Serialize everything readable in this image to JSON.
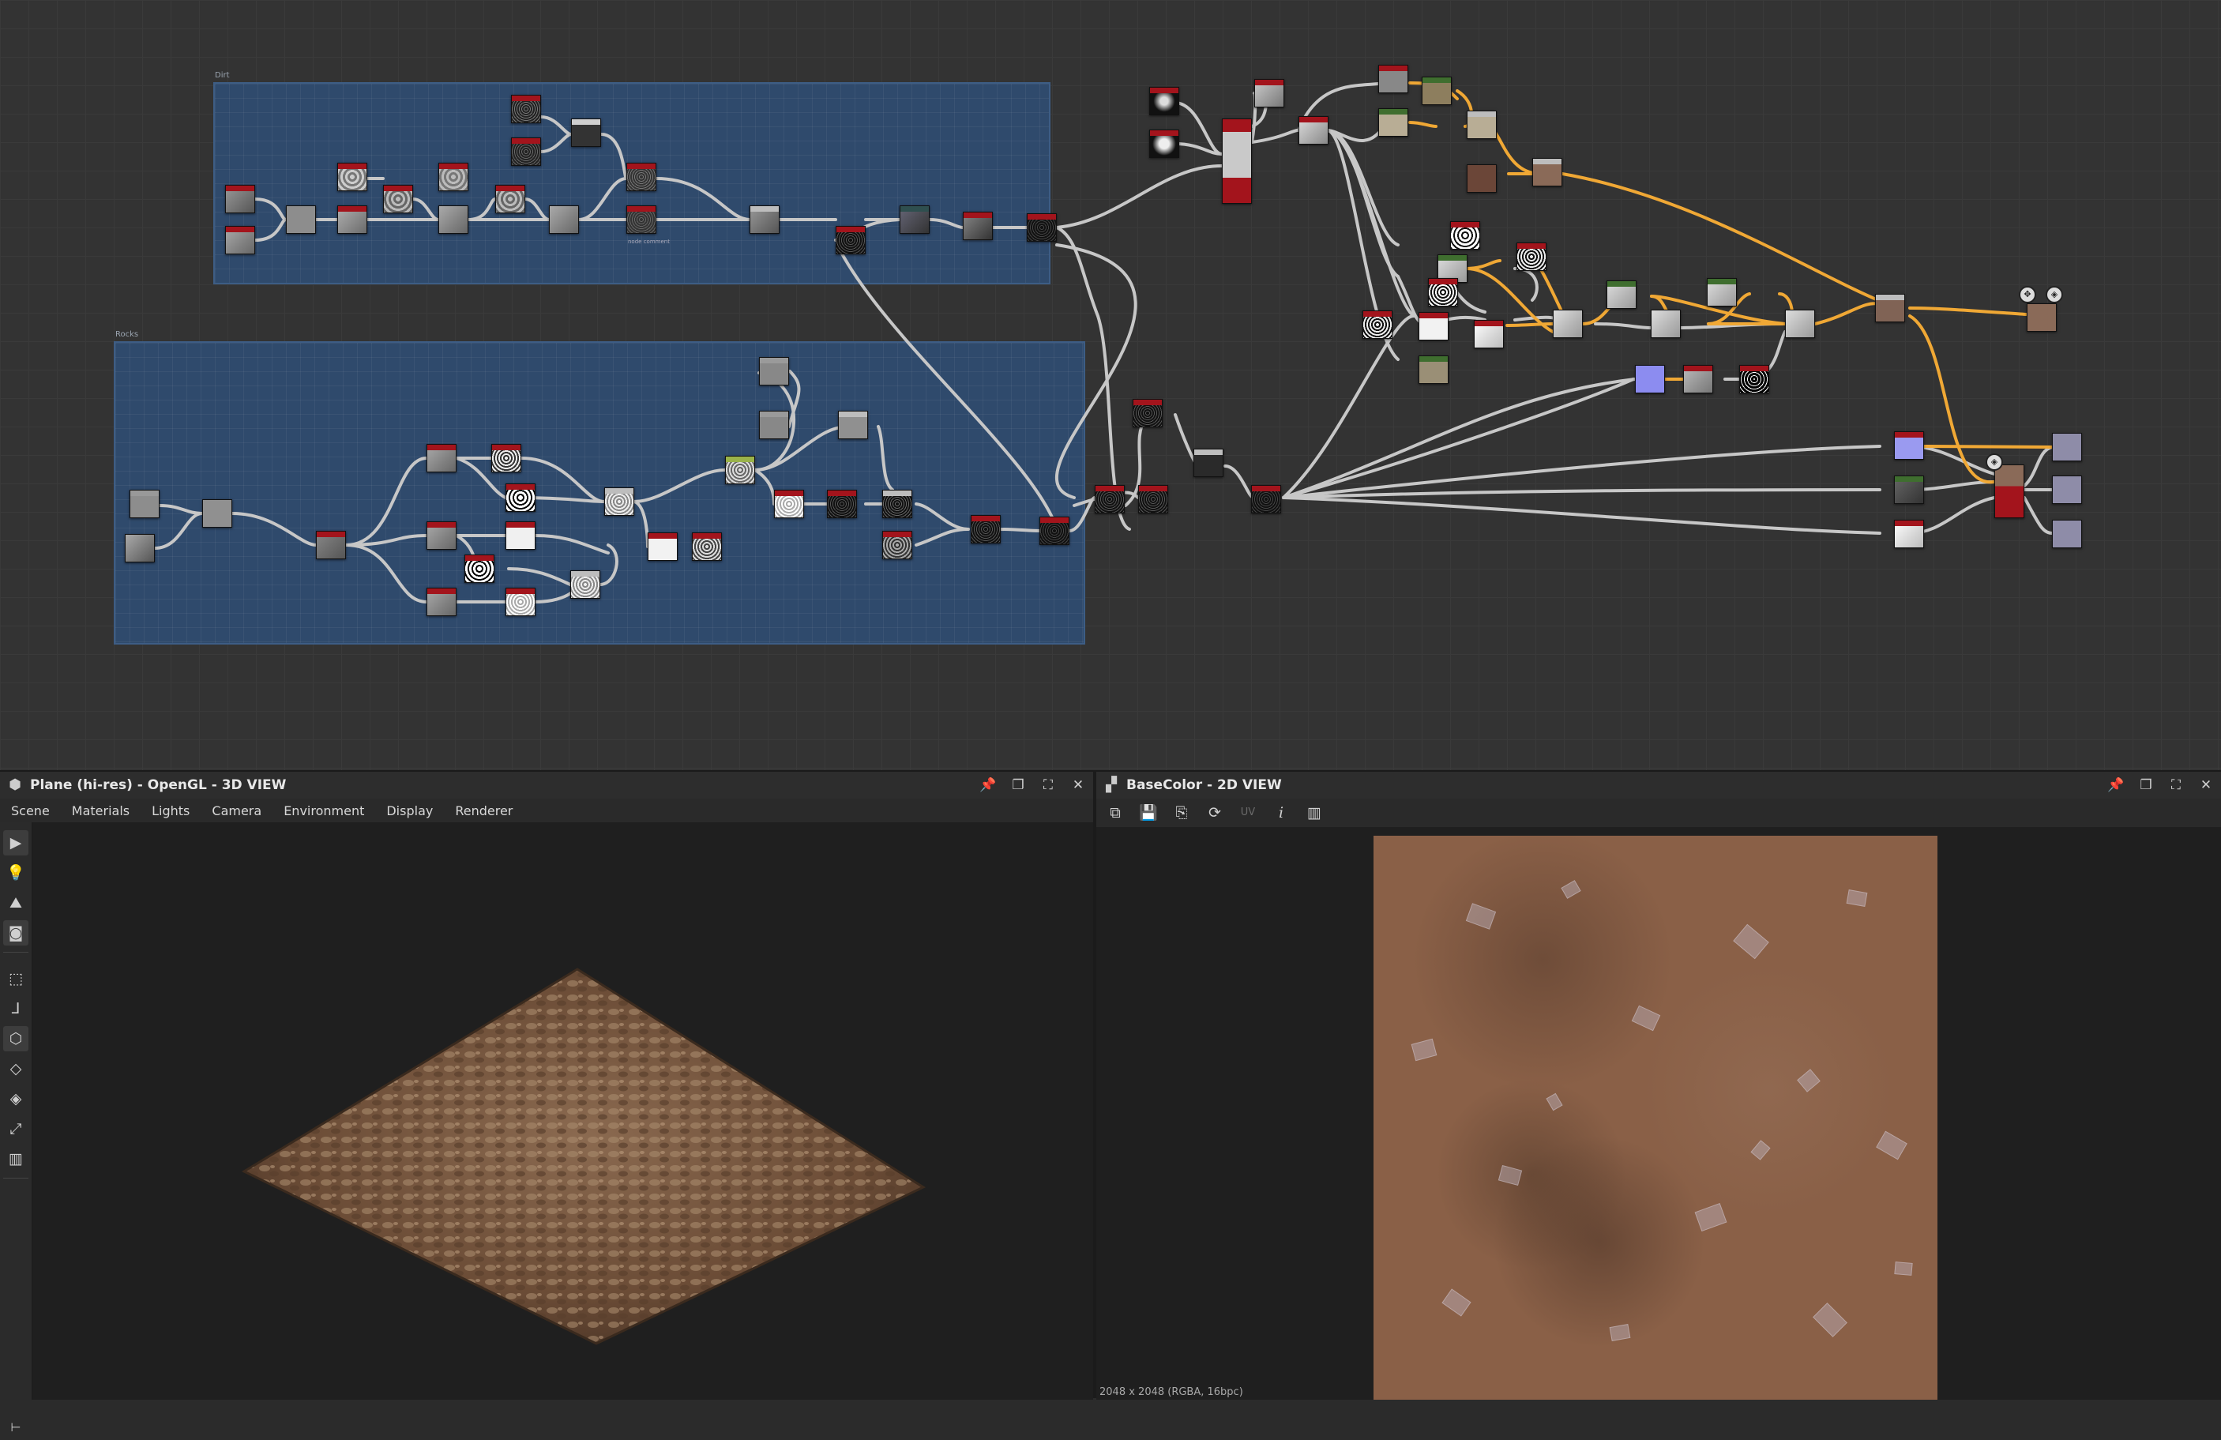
{
  "graph": {
    "frames": [
      {
        "title": "Dirt"
      },
      {
        "title": "Rocks"
      }
    ],
    "note_text": "node comment"
  },
  "panel_3d": {
    "title": "Plane (hi-res) - OpenGL - 3D VIEW",
    "icon": "cube-icon",
    "menu": [
      "Scene",
      "Materials",
      "Lights",
      "Camera",
      "Environment",
      "Display",
      "Renderer"
    ],
    "side_tools": [
      "camera-icon",
      "light-icon",
      "environment-icon",
      "screenshot-icon",
      "wireframe-icon",
      "axis-icon",
      "mesh-icon",
      "cube-outline-icon",
      "plane-icon",
      "tangent-icon",
      "chart-icon"
    ]
  },
  "panel_2d": {
    "title": "BaseColor - 2D VIEW",
    "icon": "checkerboard-icon",
    "toolbar": [
      "export-icon",
      "save-icon",
      "copy-icon",
      "refresh-icon",
      "UV",
      "info-icon",
      "histogram-icon"
    ],
    "uv_label": "UV",
    "status": "2048 x 2048 (RGBA, 16bpc)"
  },
  "colors": {
    "frame_fill": "#2f4a6c",
    "node_header": "#a3141c",
    "wire_gray": "#c7c7c7",
    "wire_orange": "#f0a835",
    "texture_base": "#8a6047"
  }
}
